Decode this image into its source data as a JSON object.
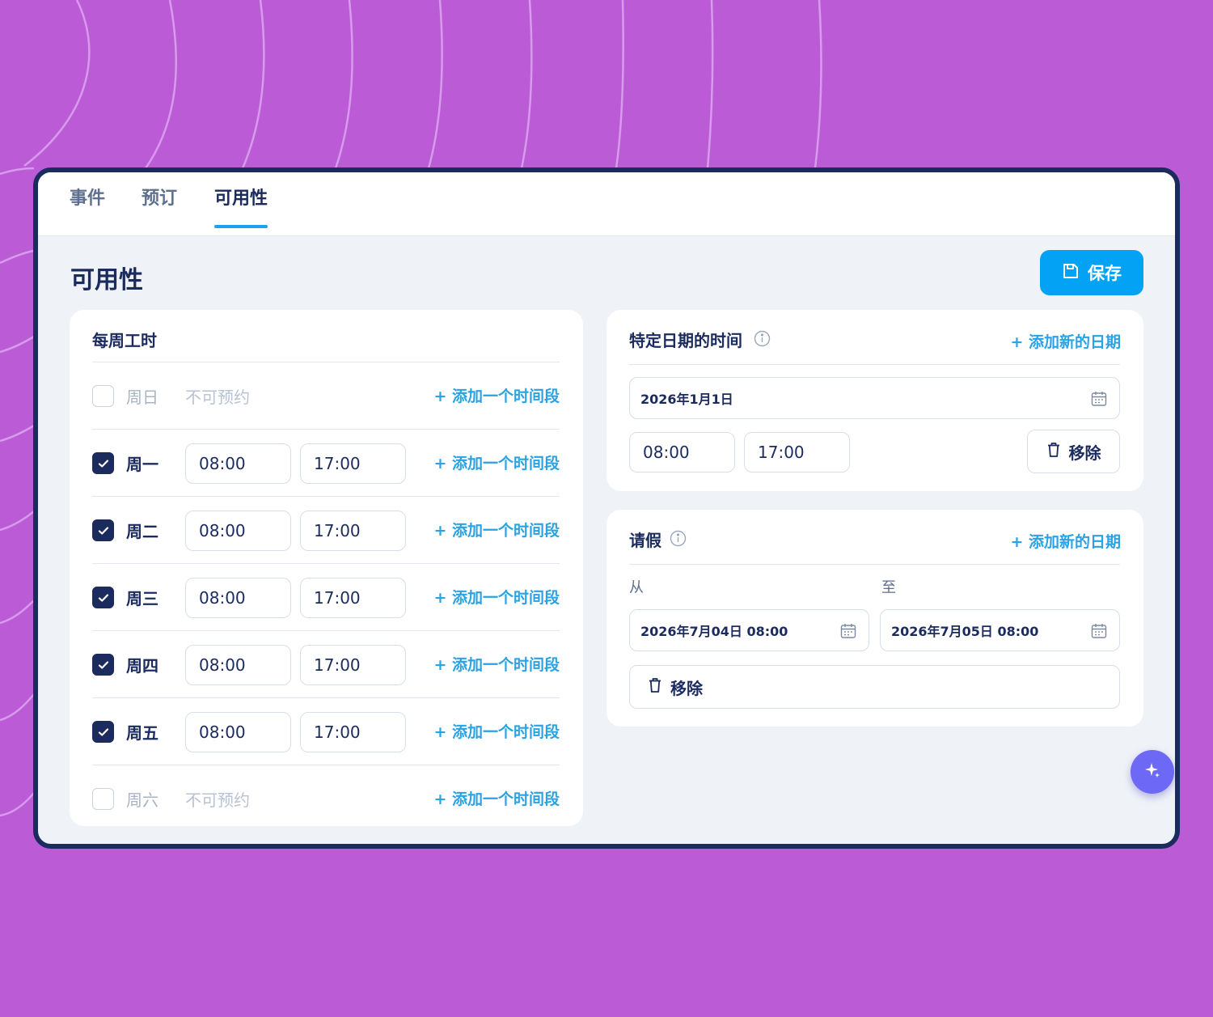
{
  "colors": {
    "background": "#bb5cd6",
    "frame_border": "#1b2b5e",
    "accent": "#03a2f5",
    "link": "#2aa2e4",
    "text_primary": "#1b2b5e",
    "fab": "#6d68f5"
  },
  "tabs": [
    {
      "label": "事件",
      "active": false
    },
    {
      "label": "预订",
      "active": false
    },
    {
      "label": "可用性",
      "active": true
    }
  ],
  "page": {
    "title": "可用性",
    "save_label": "保存",
    "save_icon": "floppy-disk-icon"
  },
  "weekly": {
    "title": "每周工时",
    "add_slot_label": "+ 添加一个时间段",
    "unavailable_label": "不可预约",
    "days": [
      {
        "day": "周日",
        "checked": false,
        "start": "",
        "end": ""
      },
      {
        "day": "周一",
        "checked": true,
        "start": "08:00",
        "end": "17:00"
      },
      {
        "day": "周二",
        "checked": true,
        "start": "08:00",
        "end": "17:00"
      },
      {
        "day": "周三",
        "checked": true,
        "start": "08:00",
        "end": "17:00"
      },
      {
        "day": "周四",
        "checked": true,
        "start": "08:00",
        "end": "17:00"
      },
      {
        "day": "周五",
        "checked": true,
        "start": "08:00",
        "end": "17:00"
      },
      {
        "day": "周六",
        "checked": false,
        "start": "",
        "end": ""
      }
    ]
  },
  "specific": {
    "title": "特定日期的时间",
    "add_date_label": "+ 添加新的日期",
    "date": "2026年1月1日",
    "start": "08:00",
    "end": "17:00",
    "remove_label": "移除"
  },
  "leave": {
    "title": "请假",
    "add_date_label": "+ 添加新的日期",
    "from_label": "从",
    "to_label": "至",
    "from_value": "2026年7月04日 08:00",
    "to_value": "2026年7月05日 08:00",
    "remove_label": "移除"
  },
  "fab": {
    "icon": "sparkle-icon"
  }
}
